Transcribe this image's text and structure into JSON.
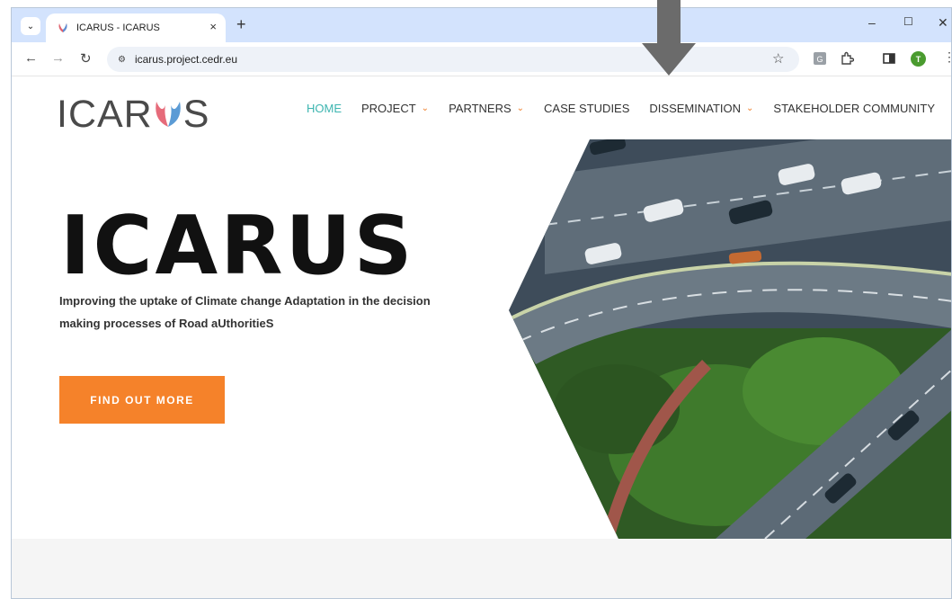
{
  "browser": {
    "tab_title": "ICARUS - ICARUS",
    "tab_close": "×",
    "new_tab": "+",
    "url": "icarus.project.cedr.eu",
    "avatar_letter": "T",
    "window_controls": {
      "minimize": "–",
      "maximize": "☐",
      "close": "✕"
    }
  },
  "site": {
    "logo_text": "ICAR",
    "logo_text_end": "S",
    "nav": [
      {
        "label": "HOME",
        "active": true,
        "dropdown": false
      },
      {
        "label": "PROJECT",
        "active": false,
        "dropdown": true
      },
      {
        "label": "PARTNERS",
        "active": false,
        "dropdown": true
      },
      {
        "label": "CASE STUDIES",
        "active": false,
        "dropdown": false
      },
      {
        "label": "DISSEMINATION",
        "active": false,
        "dropdown": true
      },
      {
        "label": "STAKEHOLDER COMMUNITY",
        "active": false,
        "dropdown": false
      }
    ],
    "hero": {
      "title": "ICARUS",
      "subtitle": "Improving the uptake of Climate change Adaptation in the decision making processes of Road aUthoritieS",
      "cta": "FIND OUT MORE"
    }
  },
  "colors": {
    "accent_teal": "#3db5b0",
    "accent_orange": "#f5822a",
    "tabstrip": "#d3e3fd"
  },
  "icons": [
    "chevron-down-icon",
    "favicon-icon",
    "back-icon",
    "forward-icon",
    "reload-icon",
    "site-settings-icon",
    "star-icon",
    "extensions-icon",
    "sidebar-icon",
    "menu-icon",
    "pointer-arrow"
  ]
}
